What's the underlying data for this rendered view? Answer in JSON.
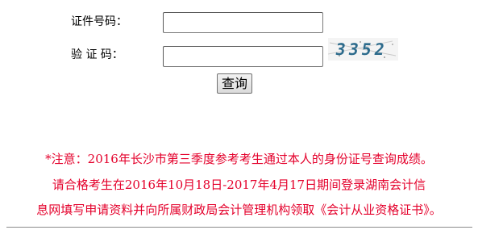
{
  "form": {
    "id_label": "证件号码：",
    "id_value": "",
    "captcha_label": "验 证 码：",
    "captcha_value": "",
    "captcha_text": "3352",
    "query_button": "查询"
  },
  "notice": {
    "line1": "*注意：2016年长沙市第三季度参考考生通过本人的身份证号查询成绩。",
    "line2": "请合格考生在2016年10月18日-2017年4月17日期间登录湖南会计信",
    "line3": "息网填写申请资料并向所属财政局会计管理机构领取《会计从业资格证书》。"
  },
  "colors": {
    "notice": "#e4002b",
    "captcha_digits": "#2d6b8c"
  }
}
